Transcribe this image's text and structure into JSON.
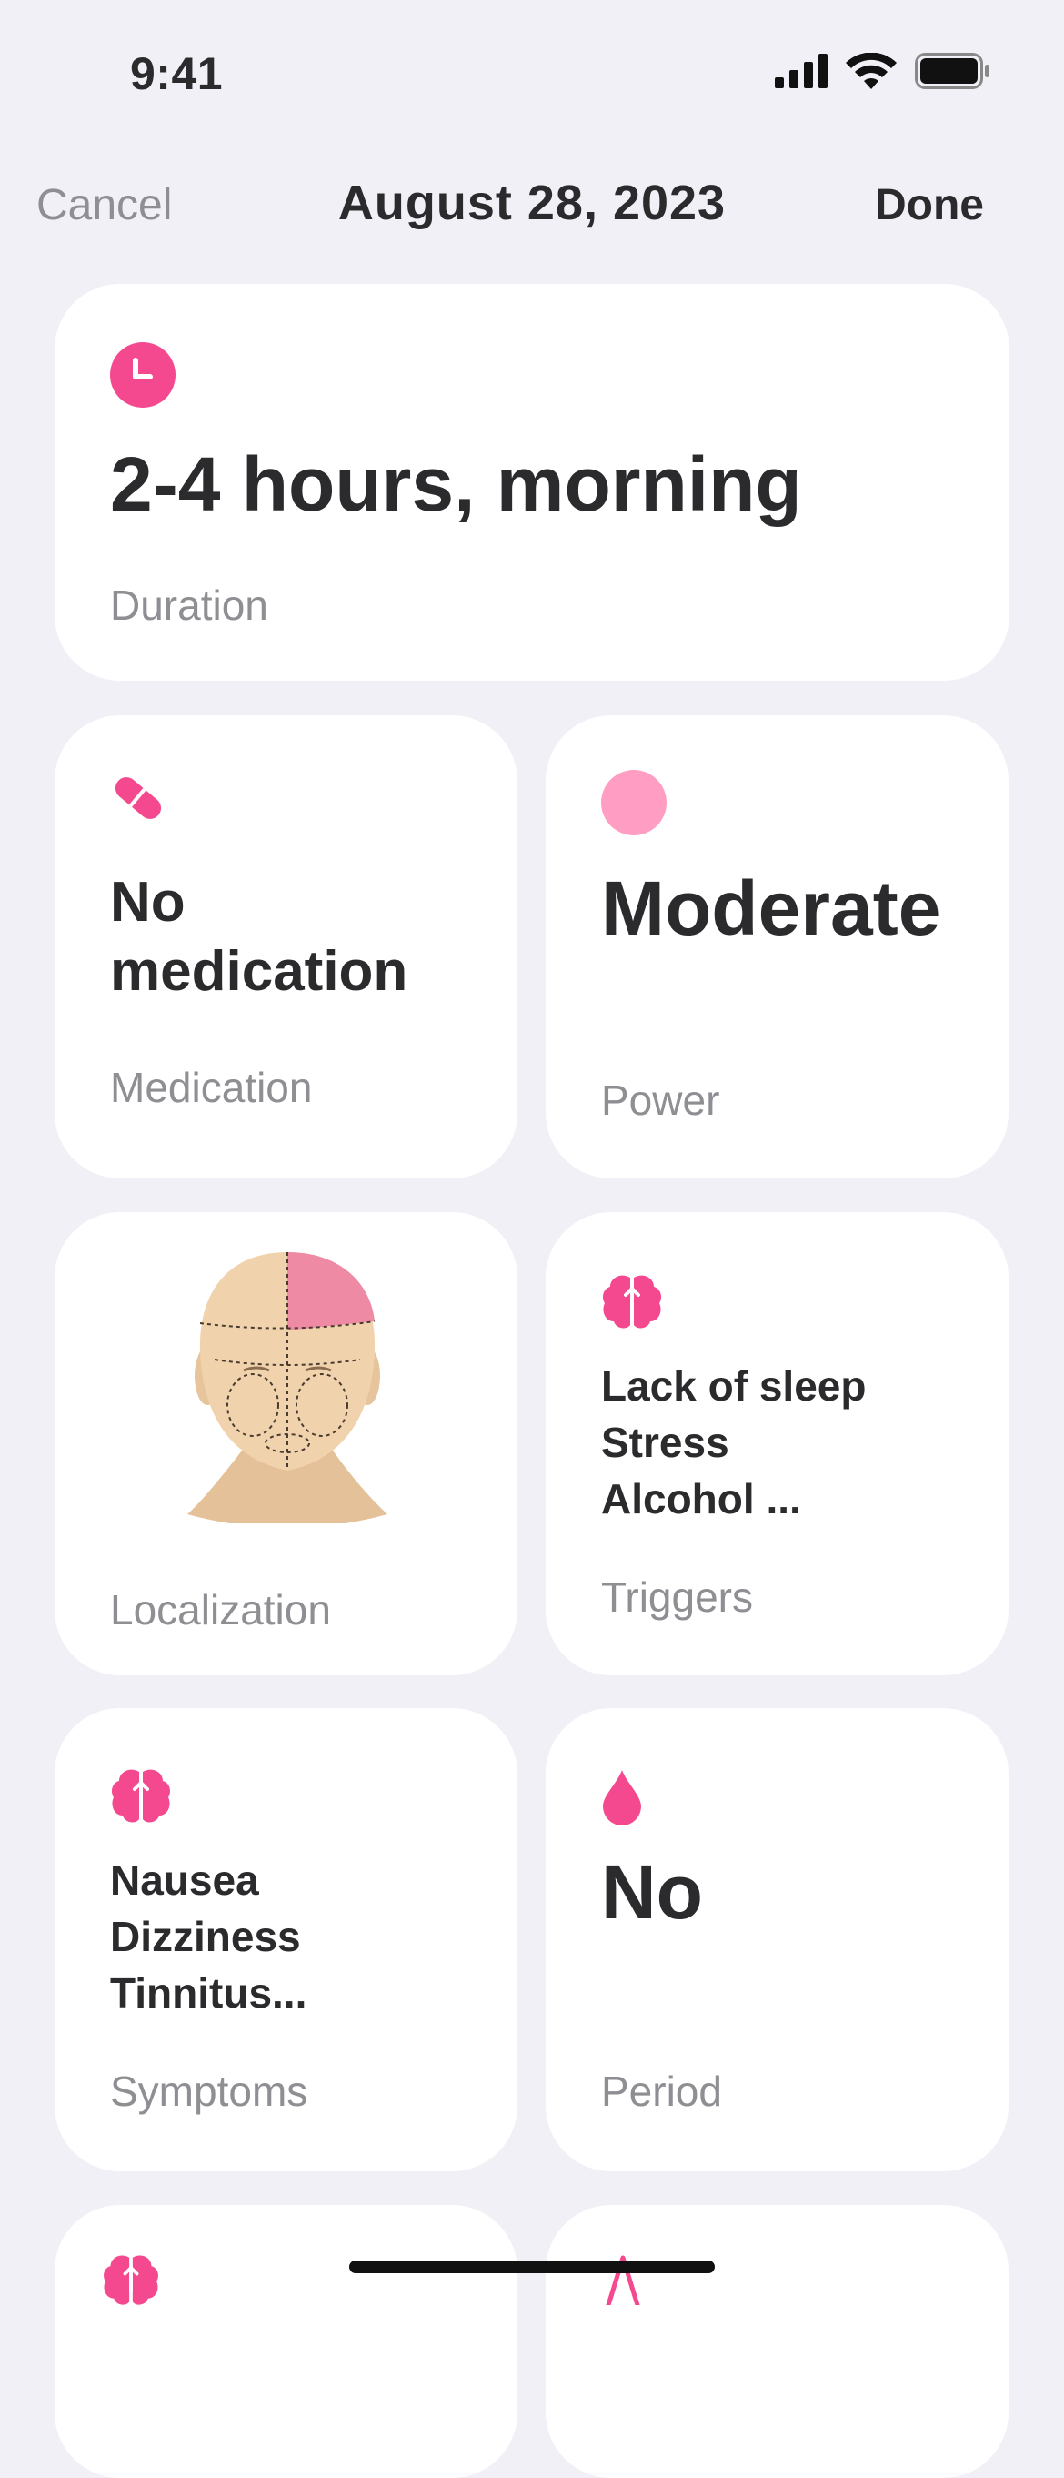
{
  "status_bar": {
    "time": "9:41"
  },
  "nav": {
    "cancel": "Cancel",
    "title": "August 28, 2023",
    "done": "Done"
  },
  "cards": {
    "duration": {
      "value": "2-4 hours, morning",
      "label": "Duration",
      "icon": "clock-icon"
    },
    "medication": {
      "value_line1": "No",
      "value_line2": "medication",
      "label": "Medication",
      "icon": "pill-icon"
    },
    "power": {
      "value": "Moderate",
      "label": "Power",
      "icon": "circle-icon"
    },
    "localization": {
      "label": "Localization"
    },
    "triggers": {
      "items": [
        "Lack of sleep",
        "Stress",
        "Alcohol ..."
      ],
      "label": "Triggers",
      "icon": "brain-icon"
    },
    "symptoms": {
      "items": [
        "Nausea",
        "Dizziness",
        "Tinnitus..."
      ],
      "label": "Symptoms",
      "icon": "brain-icon"
    },
    "period": {
      "value": "No",
      "label": "Period",
      "icon": "drop-icon"
    }
  },
  "colors": {
    "accent": "#f5498f",
    "accent_light": "#ff9dc3",
    "background": "#f1f0f6",
    "card": "#ffffff"
  }
}
